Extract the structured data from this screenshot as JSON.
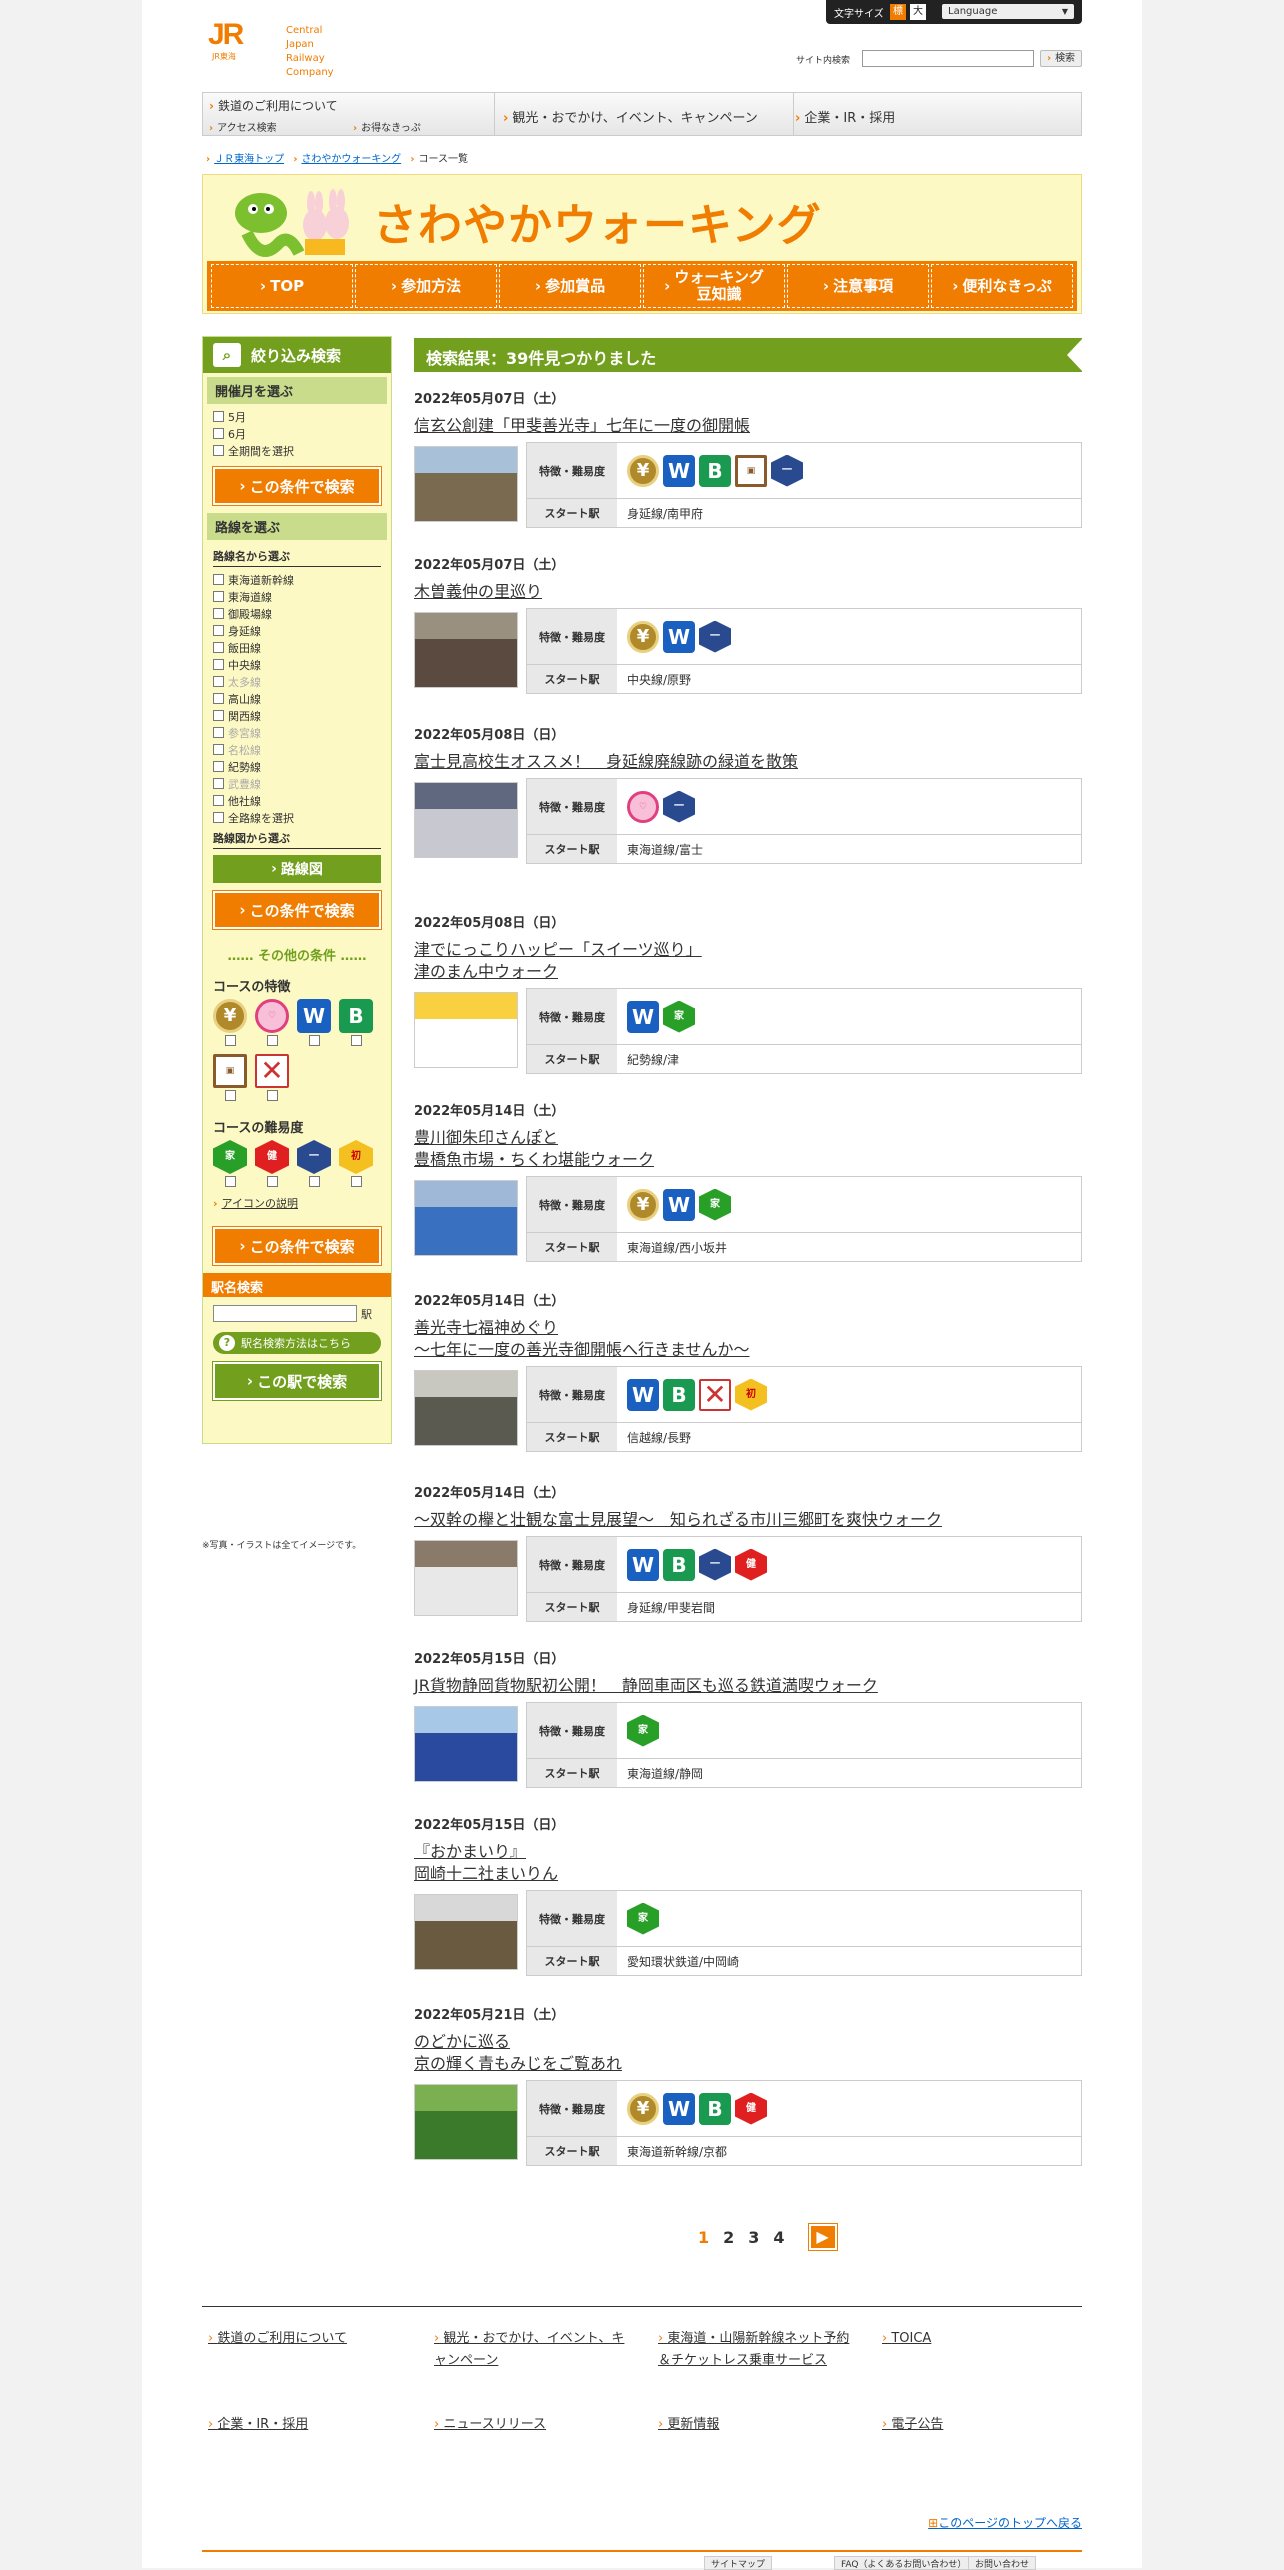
{
  "header": {
    "logo_jr": "JR",
    "logo_sub": "JR東海",
    "logo_company": [
      "Central Japan",
      "Railway Company"
    ],
    "font_size_label": "文字サイズ",
    "font_small": "標",
    "font_large": "大",
    "language": "Language",
    "search_label": "サイト内検索",
    "search_button": "検索"
  },
  "gnav": {
    "main": "鉄道のご利用について",
    "access": "アクセス検索",
    "tickets": "お得なきっぷ",
    "tourism": "観光・おでかけ、イベント、キャンペーン",
    "corporate": "企業・IR・採用"
  },
  "breadcrumb": [
    "ＪＲ東海トップ",
    "さわやかウォーキング",
    "コース一覧"
  ],
  "banner": {
    "title": "さわやかウォーキング",
    "tabs": [
      "TOP",
      "参加方法",
      "参加賞品",
      "ウォーキング\n豆知識",
      "注意事項",
      "便利なきっぷ"
    ]
  },
  "sidebar": {
    "header": "絞り込み検索",
    "month_header": "開催月を選ぶ",
    "months": [
      "5月",
      "6月",
      "全期間を選択"
    ],
    "search_button": "この条件で検索",
    "line_header": "路線を選ぶ",
    "line_name_label": "路線名から選ぶ",
    "lines": [
      {
        "name": "東海道新幹線",
        "disabled": false
      },
      {
        "name": "東海道線",
        "disabled": false
      },
      {
        "name": "御殿場線",
        "disabled": false
      },
      {
        "name": "身延線",
        "disabled": false
      },
      {
        "name": "飯田線",
        "disabled": false
      },
      {
        "name": "中央線",
        "disabled": false
      },
      {
        "name": "太多線",
        "disabled": true
      },
      {
        "name": "高山線",
        "disabled": false
      },
      {
        "name": "関西線",
        "disabled": false
      },
      {
        "name": "参宮線",
        "disabled": true
      },
      {
        "name": "名松線",
        "disabled": true
      },
      {
        "name": "紀勢線",
        "disabled": false
      },
      {
        "name": "武豊線",
        "disabled": true
      },
      {
        "name": "他社線",
        "disabled": false
      },
      {
        "name": "全路線を選択",
        "disabled": false
      }
    ],
    "map_label": "路線図から選ぶ",
    "map_button": "路線図",
    "other_conditions": "…… その他の条件 ……",
    "features_label": "コースの特徴",
    "difficulty_label": "コースの難易度",
    "icon_explain": "アイコンの説明",
    "station_header": "駅名検索",
    "station_suffix": "駅",
    "station_help": "駅名検索方法はこちら",
    "station_button": "この駅で検索"
  },
  "note": "※写真・イラストは全てイメージです。",
  "results": {
    "header": "検索結果：39件見つかりました",
    "feature_label": "特徴・難易度",
    "station_label": "スタート駅",
    "items": [
      {
        "date": "2022年05月07日（土）",
        "title": [
          "信玄公創建「甲斐善光寺」七年に一度の御開帳"
        ],
        "station": "身延線/南甲府"
      },
      {
        "date": "2022年05月07日（土）",
        "title": [
          "木曽義仲の里巡り"
        ],
        "station": "中央線/原野"
      },
      {
        "date": "2022年05月08日（日）",
        "title": [
          "富士見高校生オススメ！　身延線廃線跡の緑道を散策"
        ],
        "station": "東海道線/富士"
      },
      {
        "date": "2022年05月08日（日）",
        "title": [
          "津でにっこりハッピー「スイーツ巡り」",
          "津のまん中ウォーク"
        ],
        "station": "紀勢線/津"
      },
      {
        "date": "2022年05月14日（土）",
        "title": [
          "豊川御朱印さんぽと",
          "豊橋魚市場・ちくわ堪能ウォーク"
        ],
        "station": "東海道線/西小坂井"
      },
      {
        "date": "2022年05月14日（土）",
        "title": [
          "善光寺七福神めぐり",
          "～七年に一度の善光寺御開帳へ行きませんか～"
        ],
        "station": "信越線/長野"
      },
      {
        "date": "2022年05月14日（土）",
        "title": [
          "～双幹の欅と壮観な富士見展望～　知られざる市川三郷町を爽快ウォーク"
        ],
        "station": "身延線/甲斐岩間"
      },
      {
        "date": "2022年05月15日（日）",
        "title": [
          "JR貨物静岡貨物駅初公開！　静岡車両区も巡る鉄道満喫ウォーク"
        ],
        "station": "東海道線/静岡"
      },
      {
        "date": "2022年05月15日（日）",
        "title": [
          "『おかまいり』",
          "岡崎十二社まいりん"
        ],
        "station": "愛知環状鉄道/中岡崎"
      },
      {
        "date": "2022年05月21日（土）",
        "title": [
          "のどかに巡る",
          "京の輝く青もみじをご覧あれ"
        ],
        "station": "東海道新幹線/京都"
      }
    ]
  },
  "pager": {
    "pages": [
      "1",
      "2",
      "3",
      "4"
    ],
    "next": "▶"
  },
  "footer": {
    "links": [
      "鉄道のご利用について",
      "観光・おでかけ、イベント、キャンペーン",
      "東海道・山陽新幹線ネット予約＆チケットレス乗車サービス",
      "TOICA",
      "企業・IR・採用",
      "ニュースリリース",
      "更新情報",
      "電子公告"
    ],
    "to_top": "このページのトップへ戻る",
    "bottom": [
      "サイトマップ",
      "FAQ（よくあるお問い合わせ）",
      "お問い合わせ"
    ]
  }
}
